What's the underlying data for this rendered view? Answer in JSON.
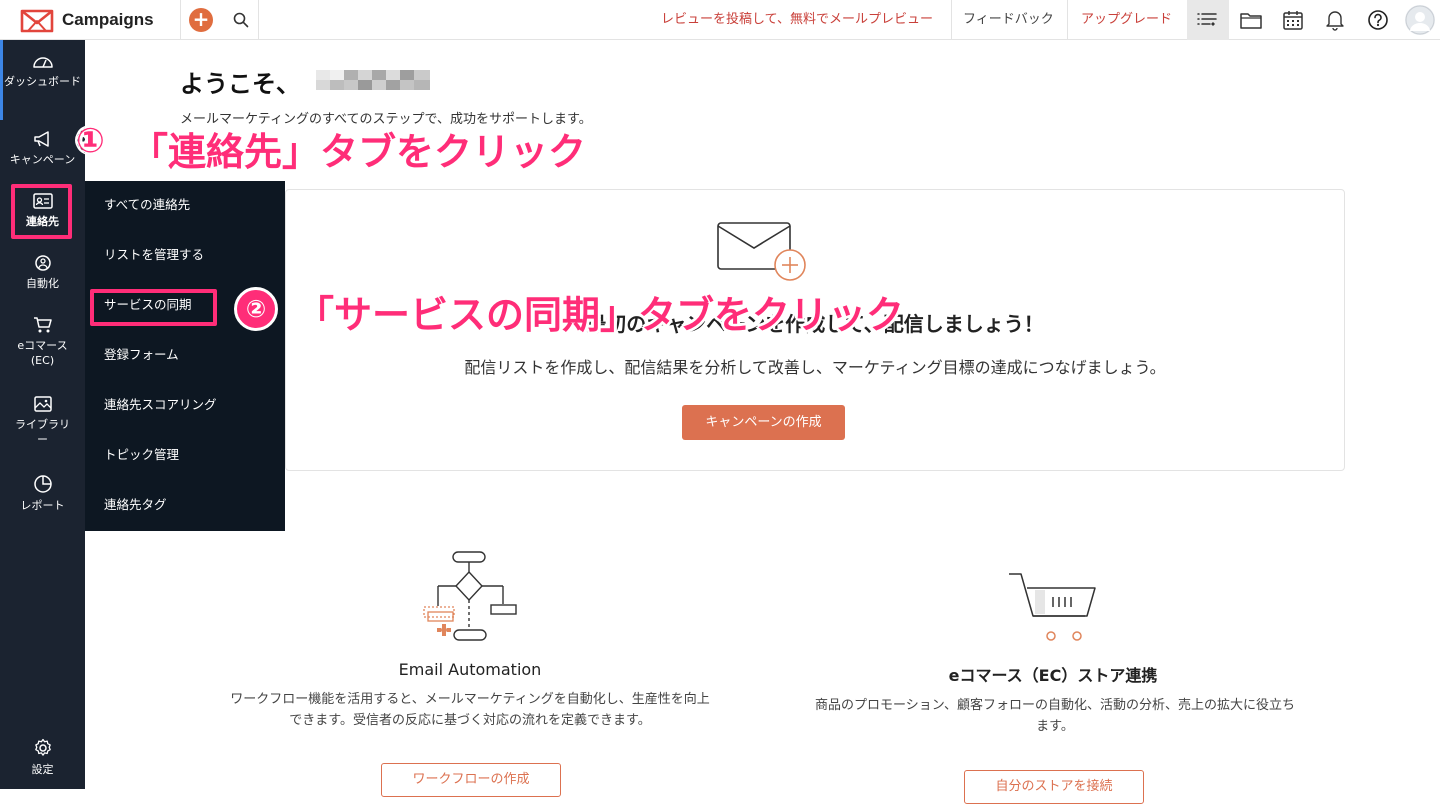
{
  "app": {
    "name": "Campaigns"
  },
  "topbar": {
    "review_link": "レビューを投稿して、無料でメールプレビュー",
    "feedback_link": "フィードバック",
    "upgrade_link": "アップグレード"
  },
  "rail": {
    "items": [
      {
        "label": "ダッシュボード",
        "icon": "dashboard-icon"
      },
      {
        "label": "キャンペーン",
        "icon": "megaphone-icon"
      },
      {
        "label": "連絡先",
        "icon": "contact-card-icon"
      },
      {
        "label": "自動化",
        "icon": "automation-icon"
      },
      {
        "label": "eコマース(EC)",
        "icon": "cart-icon"
      },
      {
        "label": "ライブラリー",
        "icon": "image-library-icon"
      },
      {
        "label": "レポート",
        "icon": "pie-chart-icon"
      },
      {
        "label": "設定",
        "icon": "gear-icon"
      }
    ]
  },
  "flyout": {
    "items": [
      "すべての連絡先",
      "リストを管理する",
      "サービスの同期",
      "登録フォーム",
      "連絡先スコアリング",
      "トピック管理",
      "連絡先タグ"
    ]
  },
  "welcome": {
    "title": "ようこそ、",
    "subtitle": "メールマーケティングのすべてのステップで、成功をサポートします。"
  },
  "hero_card": {
    "heading": "最初のキャンペーンを作成して、配信しましょう！",
    "description": "配信リストを作成し、配信結果を分析して改善し、マーケティング目標の達成につなげましょう。",
    "button": "キャンペーンの作成"
  },
  "features": [
    {
      "title": "Email Automation",
      "description_line1": "ワークフロー機能を活用すると、メールマーケティングを自動化し、生産性を向上",
      "description_line2": "できます。受信者の反応に基づく対応の流れを定義できます。",
      "button": "ワークフローの作成"
    },
    {
      "title": "eコマース（EC）ストア連携",
      "description_line1": "商品のプロモーション、顧客フォローの自動化、活動の分析、売上の拡大に役立ち",
      "description_line2": "ます。",
      "button": "自分のストアを接続"
    }
  ],
  "annotations": {
    "step1_number": "①",
    "step1_text": "「連絡先」タブをクリック",
    "step2_number": "②",
    "step2_text": "「サービスの同期」タブをクリック"
  },
  "colors": {
    "accent": "#dc7150",
    "rail_bg": "#1b2330",
    "flyout_bg": "#0d1722",
    "annotation": "#ff2d78",
    "link_red": "#c9403a"
  }
}
